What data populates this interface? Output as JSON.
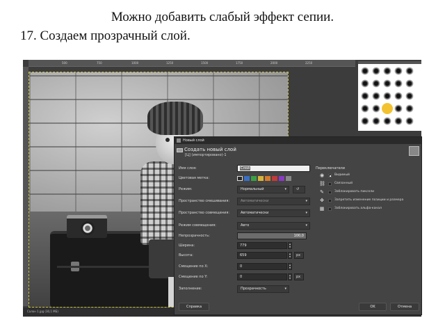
{
  "slide": {
    "line1": "Можно добавить слабый  эффект сепии.",
    "line2": "17. Создаем прозрачный слой."
  },
  "gimp": {
    "status_text": "Салон 1.jpg (30,1 МБ)",
    "ruler_ticks": [
      "500",
      "750",
      "1000",
      "1250",
      "1500",
      "1750",
      "2000",
      "2250"
    ]
  },
  "dialog": {
    "window_title": "Новый слой",
    "header_title": "Создать новый слой",
    "header_subtitle": "[Ц] (импортировано)-1",
    "fields": {
      "name_label": "Имя слоя:",
      "name_value": "Слой",
      "color_tag_label": "Цветовая метка:",
      "mode_label": "Режим:",
      "mode_value": "Нормальный",
      "blend_space_label": "Пространство смешивания:",
      "blend_space_value": "Автоматически",
      "composite_space_label": "Пространство совмещения:",
      "composite_space_value": "Автоматически",
      "composite_mode_label": "Режим совмещения:",
      "composite_mode_value": "Авто",
      "opacity_label": "Непрозрачность:",
      "opacity_value": "100,0",
      "width_label": "Ширина:",
      "width_value": "779",
      "height_label": "Высота:",
      "height_value": "659",
      "unit_value": "px",
      "offset_x_label": "Смещение по X:",
      "offset_x_value": "0",
      "offset_y_label": "Смещение по Y:",
      "offset_y_value": "0",
      "fill_label": "Заполнение:",
      "fill_value": "Прозрачность"
    },
    "switches_heading": "Переключатели",
    "switches": [
      {
        "icon": "eye-icon",
        "label": "Видимый",
        "checked": true
      },
      {
        "icon": "chain-icon",
        "label": "Связанный",
        "checked": false
      },
      {
        "icon": "brush-icon",
        "label": "Заблокировать пиксели",
        "checked": false
      },
      {
        "icon": "move-icon",
        "label": "Запретить изменение позиции и размера",
        "checked": false
      },
      {
        "icon": "checker-icon",
        "label": "Заблокировать альфа-канал",
        "checked": false
      }
    ],
    "opacity_fraction": 1.0,
    "buttons": {
      "help": "Справка",
      "ok": "OK",
      "cancel": "Отмена"
    },
    "color_tags": [
      "#2a2a2a",
      "#3a6fc4",
      "#3aa043",
      "#d6b23b",
      "#d67a2a",
      "#c33a3a",
      "#8a3ac4",
      "#888888"
    ]
  }
}
